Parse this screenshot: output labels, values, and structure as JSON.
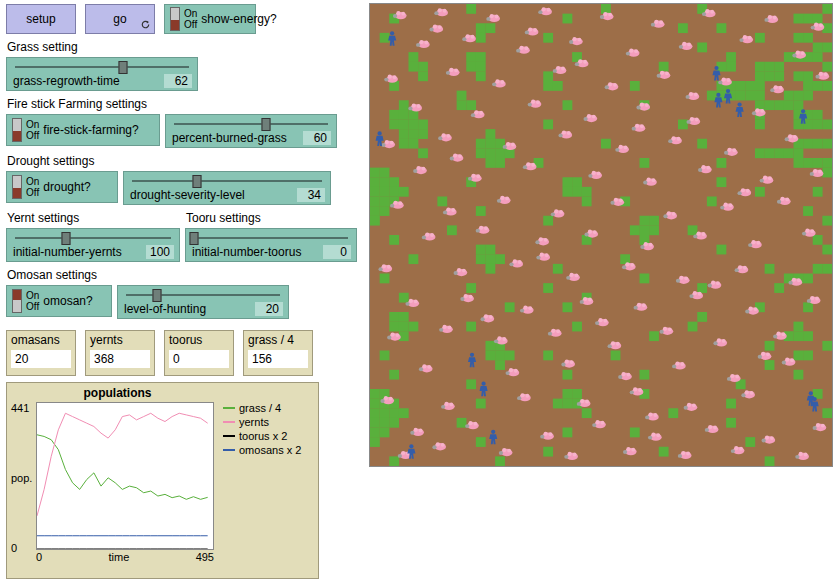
{
  "window": {
    "title": "NetLogo model interface"
  },
  "top": {
    "buttons": [
      {
        "label": "setup",
        "forever": false
      },
      {
        "label": "go",
        "forever": true
      }
    ],
    "switch": {
      "name": "show-energy?",
      "on": false,
      "labels": [
        "On",
        "Off"
      ]
    }
  },
  "sections": [
    {
      "columns": [
        {
          "heading": "Grass setting",
          "items": [
            {
              "kind": "slider",
              "name": "grass-regrowth-time",
              "value": "62",
              "level": 0.62
            }
          ]
        }
      ]
    },
    {
      "columns": [
        {
          "heading": "Fire stick Farming settings",
          "items": [
            {
              "kind": "switch",
              "name": "fire-stick-farming?",
              "on": false,
              "labels": [
                "On",
                "Off"
              ]
            },
            {
              "kind": "slider",
              "name": "percent-burned-grass",
              "value": "60",
              "level": 0.6
            }
          ]
        }
      ]
    },
    {
      "columns": [
        {
          "heading": "Drought settings",
          "items": [
            {
              "kind": "switch",
              "name": "drought?",
              "on": false,
              "labels": [
                "On",
                "Off"
              ]
            },
            {
              "kind": "slider",
              "name": "drought-severity-level",
              "value": "34",
              "level": 0.34
            }
          ]
        }
      ]
    },
    {
      "columns": [
        {
          "heading": "Yernt settings",
          "items": [
            {
              "kind": "slider",
              "name": "initial-number-yernts",
              "value": "100",
              "level": 0.33
            }
          ]
        },
        {
          "heading": "Tooru settings",
          "items": [
            {
              "kind": "slider",
              "name": "initial-number-toorus",
              "value": "0",
              "level": 0
            }
          ]
        }
      ]
    },
    {
      "columns": [
        {
          "heading": "Omosan settings",
          "items": [
            {
              "kind": "switch",
              "name": "omosan?",
              "on": true,
              "labels": [
                "On",
                "Off"
              ]
            },
            {
              "kind": "slider",
              "name": "level-of-hunting",
              "value": "20",
              "level": 0.2
            }
          ]
        }
      ]
    }
  ],
  "monitors": [
    {
      "label": "omasans",
      "value": "20"
    },
    {
      "label": "yernts",
      "value": "368"
    },
    {
      "label": "toorus",
      "value": "0"
    },
    {
      "label": "grass / 4",
      "value": "156"
    }
  ],
  "plot": {
    "title": "populations",
    "y_label": "pop.",
    "x_label": "time",
    "y_max": "441",
    "y_min": "0",
    "x_min": "0",
    "x_max": "495",
    "time": [
      0,
      20,
      40,
      60,
      80,
      100,
      120,
      140,
      160,
      180,
      200,
      220,
      240,
      260,
      280,
      300,
      320,
      340,
      360,
      380,
      400,
      420,
      440,
      460,
      480
    ],
    "series": [
      {
        "label": "grass / 4",
        "color": "#59b03c",
        "values": [
          345,
          340,
          330,
          300,
          240,
          200,
          180,
          210,
          230,
          190,
          215,
          200,
          180,
          190,
          185,
          170,
          175,
          160,
          165,
          155,
          160,
          150,
          158,
          150,
          156
        ]
      },
      {
        "label": "yernts",
        "color": "#f18db3",
        "values": [
          100,
          180,
          280,
          360,
          410,
          400,
          390,
          380,
          370,
          350,
          335,
          360,
          400,
          405,
          390,
          400,
          410,
          395,
          385,
          400,
          410,
          405,
          400,
          395,
          380
        ]
      },
      {
        "label": "toorus x 2",
        "color": "#000000",
        "values": [
          0,
          0,
          0,
          0,
          0,
          0,
          0,
          0,
          0,
          0,
          0,
          0,
          0,
          0,
          0,
          0,
          0,
          0,
          0,
          0,
          0,
          0,
          0,
          0,
          0
        ]
      },
      {
        "label": "omosans x 2",
        "color": "#345da9",
        "values": [
          40,
          40,
          40,
          40,
          40,
          40,
          40,
          40,
          40,
          40,
          40,
          40,
          40,
          40,
          40,
          40,
          40,
          40,
          40,
          40,
          40,
          40,
          40,
          40,
          40
        ]
      }
    ]
  },
  "world": {
    "grass": [
      "..........#.............#.........#............##.",
      "..#.................#.......................###.",
      "...........##...................#...#..........####.",
      ".#.........#......#.....................#...##..###.",
      "..................................#...........#####..",
      "....#.....##.........#...............#.....####....",
      "....##....##..................#.....##..###....#",
      ".....#.....#......#.....................###.##....##",
      "..#...............##.......#........#####....###",
      ".........#.........................######..###",
      "...#.....##.........#.......#...........#####......",
      "..###...................................#...###.######.#",
      "..####............#.............#.......#...#######.",
      "...###......#.......................................######.",
      "...##......###..........#.........#.........######",
      ".....#.....####.........................#####",
      "............##...#..........#.......#.......####",
      "##.............................................#..###",
      "###.......#.........##..............#............##",
      "####................###.................#.....#.",
      "###....#..............#...#........#...........",
      "##.........#.................................#.....",
      "#.................#.........##.................#...",
      "........#..................###...#..............",
      "..#...................#.....#.................#.....",
      "...........##.......................#..........#.",
      "....#......###............#...................",
      "............#......#.....................#....##...",
      ".#..........................#..............###..",
      "..........#.......#...............#.......#...",
      "...#..................#.........................",
      "..............#.....#...................#....#......",
      "..##..............................#.............",
      "..###.....#..........#...........#..........#...",
      "...#.........................#.............###...",
      "............##...........................#.....####..",
      ".#..........###...#......#..................##...",
      ".............#...........................#........",
      "..#.................#.......#...............#.......",
      "..........#...........................#.........",
      "##..................##......#.................#....",
      "###........#.......###...............#..........",
      "####..................#........#...............#.....",
      "###......#...........................#.............##",
      "##..................#......#.......................####",
      "#..........#...........................#........###",
      "..................#...........#..................##",
      "..#..........#...........................#........."
    ],
    "yernts": [
      [
        3.1,
        1.2
      ],
      [
        7.4,
        0.9
      ],
      [
        12.8,
        1.5
      ],
      [
        18.2,
        0.8
      ],
      [
        24.6,
        1.3
      ],
      [
        29.9,
        2.1
      ],
      [
        35.2,
        1.0
      ],
      [
        41.7,
        1.6
      ],
      [
        46.5,
        2.4
      ],
      [
        5.5,
        4.2
      ],
      [
        10.3,
        3.6
      ],
      [
        15.9,
        4.8
      ],
      [
        21.4,
        3.9
      ],
      [
        27.3,
        5.1
      ],
      [
        32.8,
        4.4
      ],
      [
        39.1,
        3.7
      ],
      [
        44.6,
        5.3
      ],
      [
        2.2,
        7.8
      ],
      [
        8.6,
        7.1
      ],
      [
        13.4,
        8.3
      ],
      [
        19.7,
        6.9
      ],
      [
        25.1,
        8.6
      ],
      [
        30.5,
        7.4
      ],
      [
        36.9,
        8.1
      ],
      [
        42.3,
        8.9
      ],
      [
        47.0,
        7.5
      ],
      [
        4.7,
        10.8
      ],
      [
        11.2,
        11.5
      ],
      [
        17.1,
        10.4
      ],
      [
        22.9,
        11.9
      ],
      [
        28.4,
        10.7
      ],
      [
        33.6,
        12.2
      ],
      [
        40.4,
        11.3
      ],
      [
        1.9,
        14.6
      ],
      [
        7.8,
        13.9
      ],
      [
        14.5,
        14.8
      ],
      [
        20.3,
        13.6
      ],
      [
        26.2,
        15.1
      ],
      [
        31.7,
        14.2
      ],
      [
        37.5,
        15.4
      ],
      [
        43.8,
        14.0
      ],
      [
        5.2,
        17.3
      ],
      [
        10.9,
        18.1
      ],
      [
        16.6,
        16.9
      ],
      [
        23.4,
        17.8
      ],
      [
        29.1,
        18.5
      ],
      [
        34.8,
        17.2
      ],
      [
        41.2,
        18.3
      ],
      [
        46.4,
        17.6
      ],
      [
        2.8,
        20.9
      ],
      [
        8.3,
        21.6
      ],
      [
        13.9,
        20.4
      ],
      [
        19.5,
        21.8
      ],
      [
        25.7,
        20.6
      ],
      [
        31.2,
        22.0
      ],
      [
        37.1,
        21.1
      ],
      [
        43.0,
        20.5
      ],
      [
        6.1,
        24.2
      ],
      [
        11.7,
        23.5
      ],
      [
        17.9,
        24.7
      ],
      [
        23.0,
        23.9
      ],
      [
        28.8,
        25.2
      ],
      [
        34.3,
        24.1
      ],
      [
        40.0,
        25.0
      ],
      [
        45.6,
        23.8
      ],
      [
        1.6,
        27.5
      ],
      [
        9.4,
        27.9
      ],
      [
        15.2,
        27.0
      ],
      [
        21.1,
        28.4
      ],
      [
        26.9,
        27.3
      ],
      [
        32.5,
        28.7
      ],
      [
        38.6,
        27.6
      ],
      [
        44.2,
        28.9
      ],
      [
        4.4,
        31.1
      ],
      [
        10.1,
        30.6
      ],
      [
        16.3,
        31.8
      ],
      [
        22.5,
        30.9
      ],
      [
        28.1,
        31.5
      ],
      [
        33.9,
        30.3
      ],
      [
        39.7,
        31.9
      ],
      [
        46.1,
        30.8
      ],
      [
        2.5,
        34.6
      ],
      [
        7.9,
        33.8
      ],
      [
        13.6,
        35.0
      ],
      [
        19.2,
        34.2
      ],
      [
        25.4,
        35.5
      ],
      [
        30.8,
        34.0
      ],
      [
        36.4,
        35.2
      ],
      [
        42.6,
        34.5
      ],
      [
        5.8,
        37.9
      ],
      [
        14.8,
        38.3
      ],
      [
        20.6,
        37.4
      ],
      [
        26.5,
        38.7
      ],
      [
        32.1,
        37.6
      ],
      [
        37.8,
        38.9
      ],
      [
        43.5,
        37.2
      ],
      [
        1.8,
        41.2
      ],
      [
        8.1,
        41.8
      ],
      [
        16.0,
        40.9
      ],
      [
        22.2,
        41.5
      ],
      [
        27.7,
        40.3
      ],
      [
        33.3,
        41.9
      ],
      [
        39.3,
        40.6
      ],
      [
        4.9,
        44.5
      ],
      [
        10.6,
        43.8
      ],
      [
        18.4,
        44.9
      ],
      [
        23.8,
        43.7
      ],
      [
        29.6,
        45.0
      ],
      [
        35.5,
        44.2
      ],
      [
        41.4,
        45.3
      ],
      [
        46.7,
        44.0
      ],
      [
        3.6,
        46.9
      ],
      [
        14.1,
        46.6
      ],
      [
        20.9,
        47.0
      ],
      [
        27.0,
        46.5
      ],
      [
        32.7,
        46.9
      ],
      [
        38.2,
        46.4
      ],
      [
        44.9,
        47.0
      ],
      [
        6.9,
        2.6
      ],
      [
        16.8,
        2.9
      ],
      [
        22.0,
        6.2
      ],
      [
        33.5,
        9.6
      ],
      [
        9.0,
        16.0
      ],
      [
        27.9,
        12.9
      ],
      [
        38.9,
        19.6
      ],
      [
        18.0,
        26.3
      ],
      [
        35.8,
        29.2
      ],
      [
        12.2,
        32.7
      ],
      [
        24.1,
        33.1
      ],
      [
        41.0,
        36.6
      ],
      [
        29.3,
        42.9
      ],
      [
        7.2,
        46.0
      ]
    ],
    "omosans": [
      [
        2.3,
        3.6
      ],
      [
        1.0,
        14.0
      ],
      [
        36.0,
        7.2
      ],
      [
        36.2,
        10.0
      ],
      [
        37.2,
        9.6
      ],
      [
        38.4,
        11.0
      ],
      [
        45.0,
        11.7
      ],
      [
        10.6,
        37.0
      ],
      [
        11.8,
        40.0
      ],
      [
        12.8,
        45.0
      ],
      [
        4.3,
        46.5
      ],
      [
        45.8,
        41.0
      ],
      [
        46.2,
        41.6
      ]
    ]
  }
}
